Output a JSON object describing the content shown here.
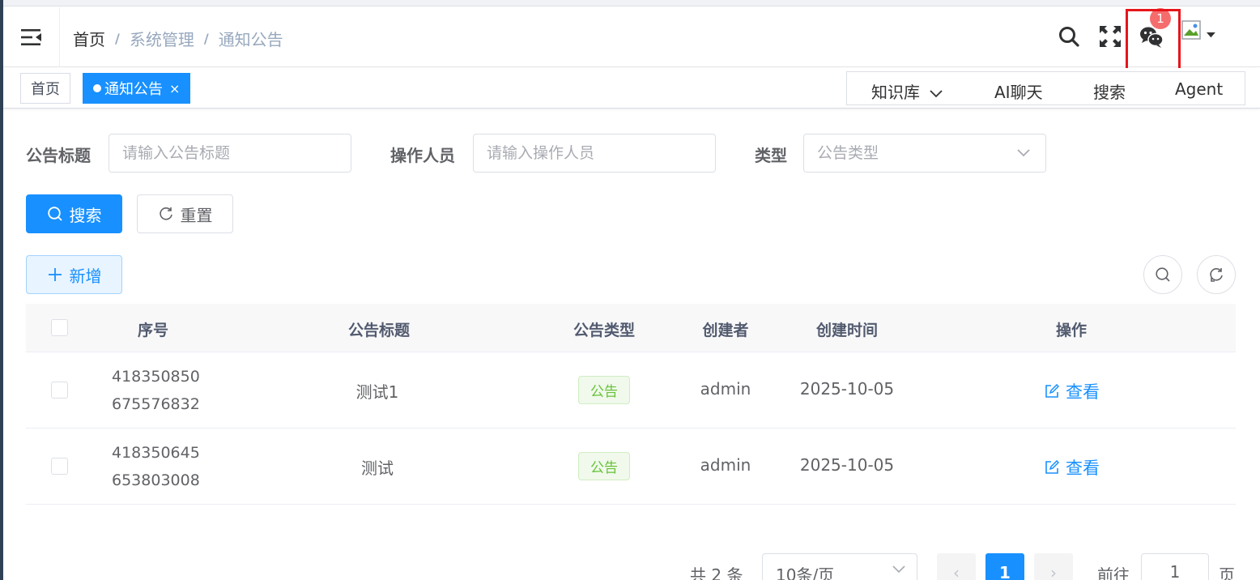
{
  "breadcrumb": {
    "home": "首页",
    "separator": "/",
    "items": [
      "系统管理",
      "通知公告"
    ]
  },
  "navbar": {
    "notification_count": "1"
  },
  "tags": [
    {
      "label": "首页",
      "active": false
    },
    {
      "label": "通知公告",
      "active": true,
      "close": "×"
    }
  ],
  "quicknav": {
    "kb": "知识库",
    "chat": "AI聊天",
    "search": "搜索",
    "agent": "Agent"
  },
  "search_form": {
    "title_label": "公告标题",
    "title_placeholder": "请输入公告标题",
    "operator_label": "操作人员",
    "operator_placeholder": "请输入操作人员",
    "type_label": "类型",
    "type_placeholder": "公告类型",
    "search_button": "搜索",
    "reset_button": "重置"
  },
  "toolbar": {
    "add_button": "新增"
  },
  "table": {
    "headers": {
      "index": "序号",
      "title": "公告标题",
      "type": "公告类型",
      "creator": "创建者",
      "created_at": "创建时间",
      "actions": "操作"
    },
    "rows": [
      {
        "id_line1": "418350850",
        "id_line2": "675576832",
        "title": "测试1",
        "type": "公告",
        "creator": "admin",
        "created_at": "2025-10-05",
        "action": "查看"
      },
      {
        "id_line1": "418350645",
        "id_line2": "653803008",
        "title": "测试",
        "type": "公告",
        "creator": "admin",
        "created_at": "2025-10-05",
        "action": "查看"
      }
    ]
  },
  "pagination": {
    "total": "共 2 条",
    "page_size": "10条/页",
    "prev": "‹",
    "current": "1",
    "next": "›",
    "goto": "前往",
    "goto_value": "1",
    "page_suffix": "页"
  },
  "colors": {
    "primary": "#1890ff",
    "success": "#67c23a",
    "danger": "#f56c6c",
    "highlight": "#e6151b"
  }
}
